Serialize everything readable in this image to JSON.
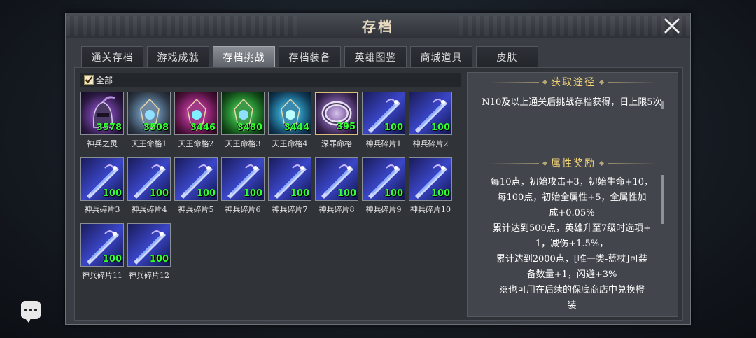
{
  "window": {
    "title": "存档"
  },
  "tabs": [
    {
      "label": "通关存档",
      "active": false
    },
    {
      "label": "游戏成就",
      "active": false
    },
    {
      "label": "存档挑战",
      "active": true
    },
    {
      "label": "存档装备",
      "active": false
    },
    {
      "label": "英雄图鉴",
      "active": false
    },
    {
      "label": "商城道具",
      "active": false
    },
    {
      "label": "皮肤",
      "active": false
    }
  ],
  "filter": {
    "label": "全部",
    "checked": true
  },
  "items": [
    {
      "name": "神兵之灵",
      "count": "3578",
      "icon": "helmet-icon"
    },
    {
      "name": "天王命格1",
      "count": "3508",
      "icon": "amulet-blue-icon"
    },
    {
      "name": "天王命格2",
      "count": "3446",
      "icon": "amulet-magenta-icon"
    },
    {
      "name": "天王命格3",
      "count": "3480",
      "icon": "amulet-green-icon"
    },
    {
      "name": "天王命格4",
      "count": "3444",
      "icon": "amulet-cyan-icon"
    },
    {
      "name": "深罪命格",
      "count": "395",
      "icon": "ring-icon"
    },
    {
      "name": "神兵碎片1",
      "count": "100",
      "icon": "sword-fragment-icon"
    },
    {
      "name": "神兵碎片2",
      "count": "100",
      "icon": "sword-fragment-icon"
    },
    {
      "name": "神兵碎片3",
      "count": "100",
      "icon": "sword-fragment-icon"
    },
    {
      "name": "神兵碎片4",
      "count": "100",
      "icon": "sword-fragment-icon"
    },
    {
      "name": "神兵碎片5",
      "count": "100",
      "icon": "sword-fragment-icon"
    },
    {
      "name": "神兵碎片6",
      "count": "100",
      "icon": "sword-fragment-icon"
    },
    {
      "name": "神兵碎片7",
      "count": "100",
      "icon": "sword-fragment-icon"
    },
    {
      "name": "神兵碎片8",
      "count": "100",
      "icon": "sword-fragment-icon"
    },
    {
      "name": "神兵碎片9",
      "count": "100",
      "icon": "sword-fragment-icon"
    },
    {
      "name": "神兵碎片10",
      "count": "100",
      "icon": "sword-fragment-icon"
    },
    {
      "name": "神兵碎片11",
      "count": "100",
      "icon": "sword-fragment-icon"
    },
    {
      "name": "神兵碎片12",
      "count": "100",
      "icon": "sword-fragment-icon"
    }
  ],
  "acquire": {
    "heading": "获取途径",
    "text": "N10及以上通关后挑战存档获得，日上限5次"
  },
  "reward": {
    "heading": "属性奖励",
    "lines": [
      "每10点，初始攻击+3，初始生命+10，",
      "每100点，初始全属性+5，全属性加",
      "成+0.05%",
      "累计达到500点，英雄升至7级时选项+",
      "1，减伤+1.5%，",
      "累计达到2000点，[唯一类-蓝杖]可装",
      "备数量+1，闪避+3%",
      "※也可用在后续的保底商店中兑换橙",
      "装"
    ]
  },
  "colors": {
    "accent_gold": "#f2d27a",
    "count_green": "#33ff33",
    "tab_active": "#8a8e95"
  }
}
